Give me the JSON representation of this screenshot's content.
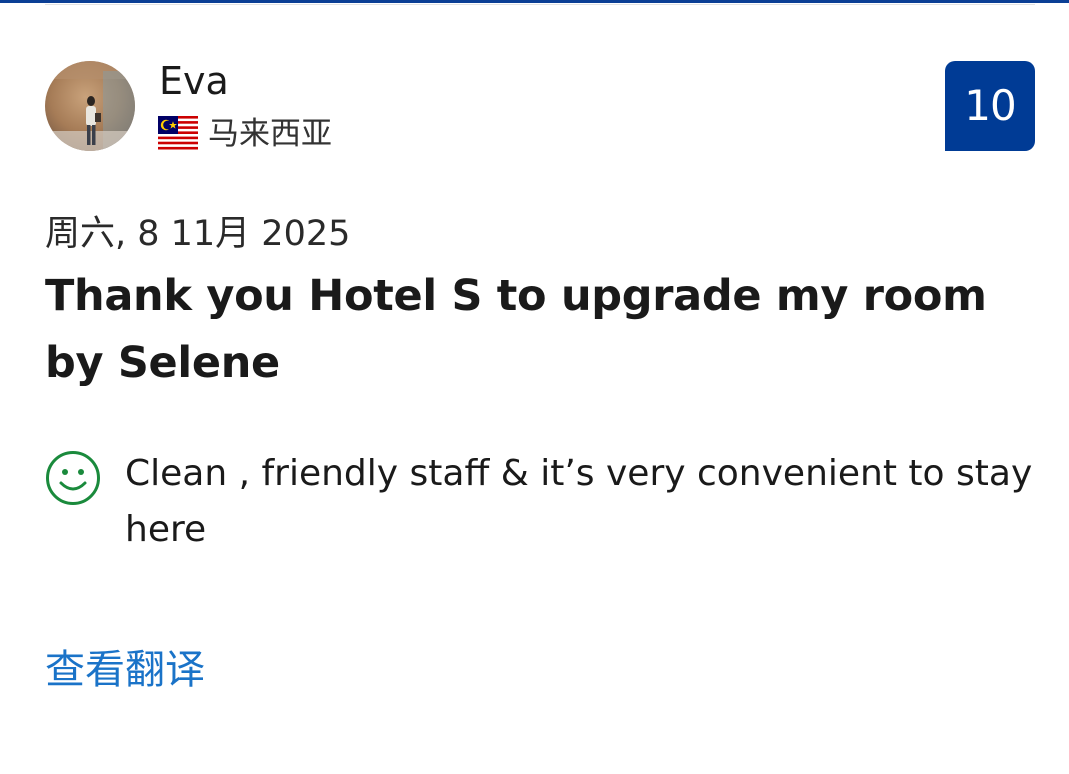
{
  "reviewer": {
    "name": "Eva",
    "country": "马来西亚",
    "avatar_icon": "reviewer-photo",
    "flag_icon": "malaysia-flag"
  },
  "score": {
    "value": "10",
    "color": "#003b95"
  },
  "review": {
    "date": "周六, 8 11月 2025",
    "title": "Thank you Hotel S to upgrade my room by Selene",
    "positive_icon": "smiley-icon",
    "positive_color": "#1a8a3c",
    "positive_text": "Clean , friendly staff & it’s very convenient to stay here"
  },
  "actions": {
    "translate_label": "查看翻译",
    "link_color": "#1a73c8"
  },
  "theme": {
    "accent": "#0b3f95"
  }
}
